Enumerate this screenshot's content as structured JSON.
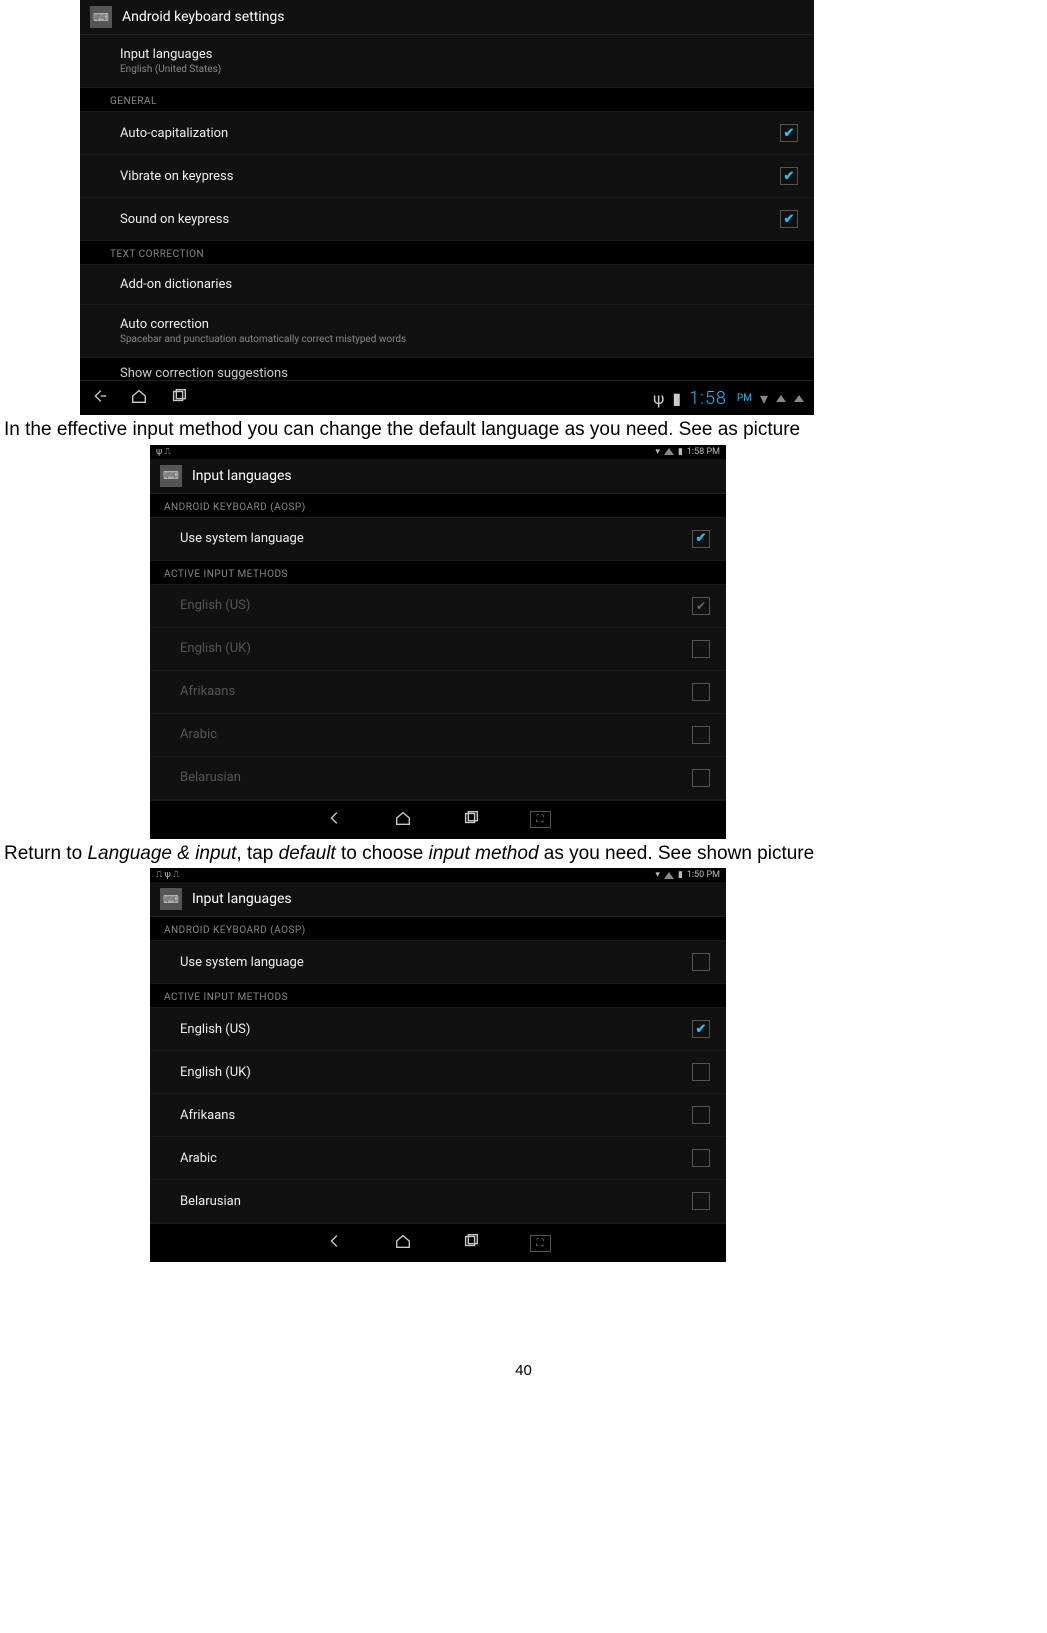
{
  "page_number": "40",
  "body": {
    "text1": "In the effective input method you can change the default language as you need. See as picture",
    "text2_pre": "Return to ",
    "text2_i1": "Language & input",
    "text2_mid1": ", tap ",
    "text2_i2": "default",
    "text2_mid2": " to choose ",
    "text2_i3": "input method",
    "text2_end": " as you need. See shown picture"
  },
  "shot1": {
    "title": "Android keyboard settings",
    "input_lang_title": "Input languages",
    "input_lang_sub": "English (United States)",
    "section_general": "GENERAL",
    "auto_cap": "Auto-capitalization",
    "vibrate": "Vibrate on keypress",
    "sound": "Sound on keypress",
    "section_textcorr": "TEXT CORRECTION",
    "addon": "Add-on dictionaries",
    "autocorr_title": "Auto correction",
    "autocorr_sub": "Spacebar and punctuation automatically correct mistyped words",
    "show_sugg": "Show correction suggestions",
    "clock": "1:58",
    "pm": "PM"
  },
  "shot2": {
    "title": "Input languages",
    "section_kb": "ANDROID KEYBOARD (AOSP)",
    "use_sys": "Use system language",
    "section_active": "ACTIVE INPUT METHODS",
    "langs": [
      "English (US)",
      "English (UK)",
      "Afrikaans",
      "Arabic",
      "Belarusian"
    ],
    "clock": "1:58 PM"
  },
  "shot3": {
    "title": "Input languages",
    "section_kb": "ANDROID KEYBOARD (AOSP)",
    "use_sys": "Use system language",
    "section_active": "ACTIVE INPUT METHODS",
    "langs": [
      "English (US)",
      "English (UK)",
      "Afrikaans",
      "Arabic",
      "Belarusian"
    ],
    "clock": "1:50 PM"
  }
}
